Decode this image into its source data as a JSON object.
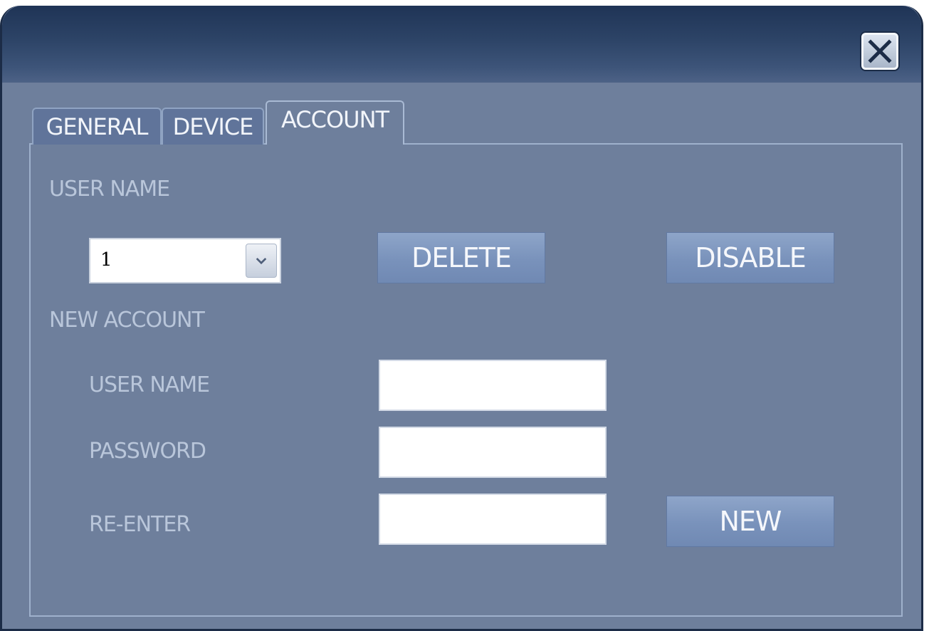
{
  "window": {
    "close_icon": "close-x-icon"
  },
  "tabs": [
    {
      "label": "GENERAL",
      "active": false
    },
    {
      "label": "DEVICE",
      "active": false
    },
    {
      "label": "ACCOUNT",
      "active": true
    }
  ],
  "account": {
    "user_name_label": "USER NAME",
    "user_select_value": "1",
    "delete_label": "DELETE",
    "disable_label": "DISABLE",
    "new_account_label": "NEW ACCOUNT",
    "new_user_name_label": "USER NAME",
    "password_label": "PASSWORD",
    "reenter_label": "RE-ENTER",
    "new_user_name_value": "",
    "password_value": "",
    "reenter_value": "",
    "new_label": "NEW"
  },
  "colors": {
    "titlebar": "#2d4467",
    "body": "#6e7f9c",
    "button": "#7992bb",
    "label_text": "#b9c6da"
  }
}
